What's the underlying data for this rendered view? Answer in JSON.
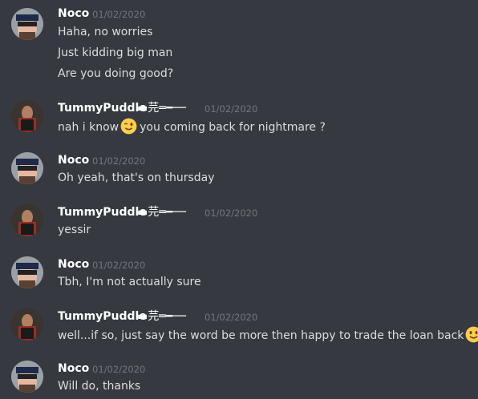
{
  "users": {
    "noco": "Noco",
    "tummy": "TummyPuddle",
    "tummy_deco": "▬芫═━──"
  },
  "icons": {
    "wink": "wink-emoji",
    "smile": "slight-smile-emoji"
  },
  "messages": [
    {
      "author": "Noco",
      "time": "01/02/2020",
      "lines": [
        "Haha, no worries",
        "Just kidding big man",
        "Are you doing good?"
      ]
    },
    {
      "author": "TummyPuddle",
      "time": "01/02/2020",
      "lines": [
        "nah i know",
        "you coming back for nightmare ?"
      ]
    },
    {
      "author": "Noco",
      "time": "01/02/2020",
      "lines": [
        "Oh yeah, that's on thursday"
      ]
    },
    {
      "author": "TummyPuddle",
      "time": "01/02/2020",
      "lines": [
        "yessir"
      ]
    },
    {
      "author": "Noco",
      "time": "01/02/2020",
      "lines": [
        "Tbh, I'm not actually sure"
      ]
    },
    {
      "author": "TummyPuddle",
      "time": "01/02/2020",
      "lines": [
        "well...if so, just say the word be more then happy to trade the loan back"
      ]
    },
    {
      "author": "Noco",
      "time": "01/02/2020",
      "lines": [
        "Will do, thanks"
      ]
    }
  ]
}
